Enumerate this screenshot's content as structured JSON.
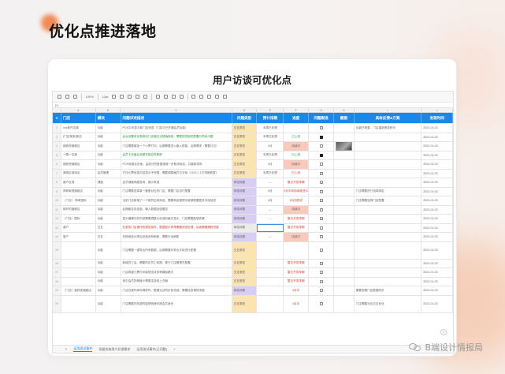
{
  "page": {
    "title": "优化点推进落地"
  },
  "card": {
    "title": "用户访谈可优化点"
  },
  "toolbar": {
    "zoom": "100%",
    "font_size": "10pt"
  },
  "formula": {
    "cell_ref": "E1"
  },
  "columns": [
    "A",
    "B",
    "C",
    "D",
    "E",
    "F",
    "G",
    "H",
    "I",
    "J"
  ],
  "table": {
    "headers": [
      "门店",
      "模块",
      "问题详述描述",
      "问题类别",
      "预计排期",
      "进度",
      "问题跟进",
      "截图",
      "具体反馈&方案",
      "发现时间"
    ],
    "rows": [
      {
        "n": "2",
        "a": "xxx新开店铺",
        "b": "功能",
        "c": "POS中未显示新门店信息（门店中已开通会员功能）",
        "d": "交互类型",
        "dt": "yellow",
        "e": "本周已处理",
        "f": "",
        "g": "off",
        "h": false,
        "i": "功能已修复，门店重新登录即可",
        "j": "2022-01-03",
        "cc": ""
      },
      {
        "n": "3",
        "a": "(门店某某)新店",
        "b": "功能",
        "c": "后台设置有优惠券但门店端无法核销使用，需要排查相关配置与同步问题",
        "d": "交互类型",
        "dt": "yellow",
        "e": "本周已处理",
        "f": "已上线",
        "ft": "green",
        "g": "on",
        "h": false,
        "i": "",
        "j": "2022-01-03",
        "cc": "green"
      },
      {
        "n": "4",
        "a": "钢铁侠旗舰店",
        "b": "功能",
        "c": "门店需要增加一个小票打印，后期需要进入输入框能，后期需求（需要讨论）",
        "d": "交互类型",
        "dt": "yellow",
        "e": "4月",
        "f": "持续中",
        "fbg": "pink",
        "g": "off",
        "h": true,
        "i": "",
        "j": "2022-01-03",
        "cc": ""
      },
      {
        "n": "5",
        "a": "一路一店铺",
        "b": "功能",
        "c": "会员卡充值后余额未能实时刷新",
        "d": "交互类型",
        "dt": "yellow",
        "e": "本周已处理",
        "f": "已上线",
        "ft": "green",
        "g": "on",
        "h": false,
        "i": "",
        "j": "2022-01-03",
        "cc": "green"
      },
      {
        "n": "6",
        "a": "钢铁侠旗舰店",
        "b": "功能",
        "c": "POS收银台页面，由部分的数据错误一步取消添加，并重新排序",
        "d": "交互类型",
        "dt": "yellow",
        "e": "4月",
        "f": "持续中",
        "fbg": "pink",
        "g": "off",
        "h": false,
        "i": "",
        "j": "2022-01-03",
        "cc": ""
      },
      {
        "n": "7",
        "a": "美丽区商场店",
        "b": "会员管理",
        "c": "打印小票信息内容显示不完整，需要调整格式与字段（2022.1.1已排期修复）",
        "d": "交互类型",
        "dt": "yellow",
        "e": "本周已处理",
        "f": "已上线",
        "ft": "red",
        "g": "off",
        "h": false,
        "i": "",
        "j": "2022-01-03",
        "cc": ""
      },
      {
        "n": "8",
        "a": "客户反馈",
        "b": "储值",
        "c": "会员储值明细查询，展示有误",
        "d": "体验问题",
        "dt": "purple",
        "e": "—",
        "f": "暂无开发排期",
        "ft": "red",
        "g": "off",
        "h": false,
        "i": "",
        "j": "2022-01-03",
        "cc": ""
      },
      {
        "n": "9",
        "a": "佩奇家具旗舰店",
        "b": "功能",
        "c": "门店需要选择某一套账对应的门店，需要门店自行配置",
        "d": "体验问题",
        "dt": "purple",
        "e": "4月",
        "f": "4月中旬持续推进中",
        "ft": "red",
        "g": "off",
        "h": false,
        "i": "门店需要进行选择绑定",
        "j": "2022-01-03",
        "cc": ""
      },
      {
        "n": "10",
        "a": "（门店） 佩奇国际",
        "b": "功能",
        "c": "当前门店新增了一个新的应用商品，需要商品管理中能够配置更多字段信息",
        "d": "体验问题",
        "dt": "purple",
        "e": "4月",
        "f": "4月初完成",
        "ft": "red",
        "g": "off",
        "h": false,
        "i": "门店需要选择门店配置",
        "j": "2022-01-03",
        "cc": ""
      },
      {
        "n": "11",
        "a": "那好的旗舰店",
        "b": "功能",
        "c": "后期都支持连锁，输入数据加强管控",
        "d": "体验问题",
        "dt": "purple",
        "e": "—",
        "f": "持续中",
        "fbg": "pink",
        "g": "off",
        "h": false,
        "i": "",
        "j": "2022-01-03",
        "cc": ""
      },
      {
        "n": "12",
        "a": "（门店）国际",
        "b": "功能",
        "c": "显示编辑中的内容需要调整为标准的格式显示，门店需要能够查看",
        "d": "体验问题",
        "dt": "purple",
        "e": "—",
        "f": "暂无开发排期",
        "ft": "red",
        "g": "off",
        "h": false,
        "i": "",
        "j": "2022-01-03",
        "cc": ""
      },
      {
        "n": "13",
        "a": "客户",
        "b": "交互",
        "c": "在新的门店操作收银信息时，数据显示异常需要排查处理，后续需要跟踪进度",
        "d": "体验问题",
        "dt": "gray",
        "e": "",
        "f": "暂无开发排期",
        "ft": "red",
        "g": "off",
        "h": false,
        "i": "",
        "j": "2022-01-03",
        "cc": "red",
        "sel": true
      },
      {
        "n": "14",
        "a": "客户",
        "b": "交互",
        "c": "切换商品分类后页面没有刷新，需要手动刷新",
        "d": "体验问题",
        "dt": "purple",
        "e": "—",
        "f": "持续中",
        "fbg": "pink",
        "g": "off",
        "h": false,
        "i": "",
        "j": "2022-01-03",
        "cc": ""
      },
      {
        "n": "15",
        "a": "",
        "b": "功能",
        "c": "门店需要一键导出所有数据，后期需要对导出字段进行配置",
        "d": "交互类型",
        "dt": "yellow",
        "e": "",
        "f": "",
        "g": "off",
        "h": false,
        "i": "",
        "j": "2022-01-03",
        "cc": "",
        "tall": true
      },
      {
        "n": "16",
        "a": "",
        "b": "功能",
        "c": "新增员工后，需要同步员工权限，便于门店管理员配置",
        "d": "交互类型",
        "dt": "yellow",
        "e": "",
        "f": "暂无开发排期",
        "ft": "red",
        "g": "off",
        "h": false,
        "i": "",
        "j": "2022-01-03",
        "cc": ""
      },
      {
        "n": "17",
        "a": "",
        "b": "功能",
        "c": "门店希望小票打印能够支持多种模板格式",
        "d": "交互类型",
        "dt": "yellow",
        "e": "",
        "f": "暂无开发排期",
        "ft": "red",
        "g": "off",
        "h": false,
        "i": "",
        "j": "2022-01-03",
        "cc": ""
      },
      {
        "n": "18",
        "a": "",
        "b": "功能",
        "c": "其中会员的储值卡需要支持线上充值",
        "d": "交互类型",
        "dt": "yellow",
        "e": "",
        "f": "暂无开发排期",
        "ft": "red",
        "g": "off",
        "h": false,
        "i": "",
        "j": "2022-01-03",
        "cc": ""
      },
      {
        "n": "19",
        "a": "（门店）钢铁侠旗舰店",
        "b": "功能",
        "c": "门店在操作库存调拨时，数据无法同步到总部，需要检查调拨流程",
        "d": "体验问题",
        "dt": "purple",
        "e": "",
        "f": "4月中",
        "ft": "red",
        "g": "off",
        "h": false,
        "i": "需要查看门店数据同步",
        "j": "2022-01-03",
        "cc": ""
      },
      {
        "n": "20",
        "a": "",
        "b": "功能",
        "c": "门店需要在收银时能够快速切换会员身份",
        "d": "交互类型",
        "dt": "yellow",
        "e": "",
        "f": "4月中",
        "ft": "red",
        "g": "off",
        "h": false,
        "i": "门店需要对应交互优化",
        "j": "2022-01-03",
        "cc": "",
        "tall": true
      }
    ]
  },
  "tabs": [
    "运用测试事件",
    "测量系统用户反馈需求",
    "运用测试事件(已问题)"
  ],
  "watermark": {
    "text": "B端设计情报局"
  }
}
